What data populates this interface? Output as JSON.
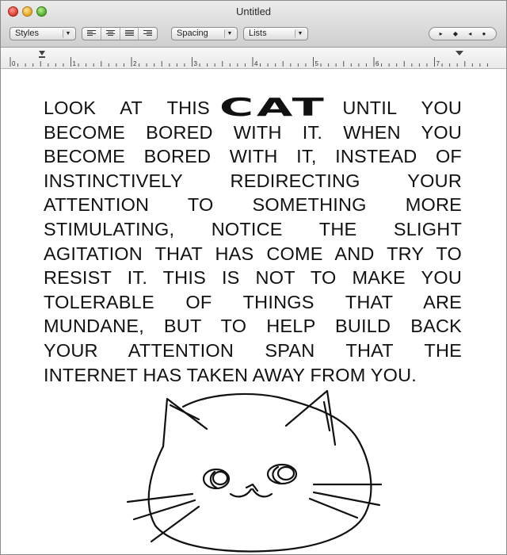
{
  "window": {
    "title": "Untitled"
  },
  "toolbar": {
    "styles_label": "Styles",
    "spacing_label": "Spacing",
    "lists_label": "Lists",
    "align_buttons": [
      "align-left",
      "align-center",
      "align-justify",
      "align-right"
    ],
    "nav_glyphs": [
      "▸",
      "◆",
      "◂",
      "●"
    ]
  },
  "ruler": {
    "numbers": [
      "0",
      "1",
      "2",
      "3",
      "4",
      "5",
      "6",
      "7"
    ]
  },
  "document": {
    "lines": [
      "LOOK AT THIS",
      "UNTIL YOU",
      "BECOME BORED WITH IT. WHEN YOU",
      "BECOME BORED WITH IT, INSTEAD OF",
      "INSTINCTIVELY REDIRECTING YOUR",
      "ATTENTION TO SOMETHING MORE",
      "STIMULATING, NOTICE THE SLIGHT",
      "AGITATION THAT HAS COME AND TRY TO",
      "RESIST IT. THIS IS NOT TO MAKE YOU",
      "TOLERABLE OF THINGS THAT ARE",
      "MUNDANE, BUT TO HELP BUILD BACK",
      "YOUR ATTENTION SPAN THAT THE",
      "INTERNET HAS TAKEN AWAY FROM YOU."
    ],
    "cat_word": "CAT"
  },
  "colors": {
    "text": "#111111",
    "window_bg": "#ffffff",
    "titlebar": "#d9d9d9"
  }
}
